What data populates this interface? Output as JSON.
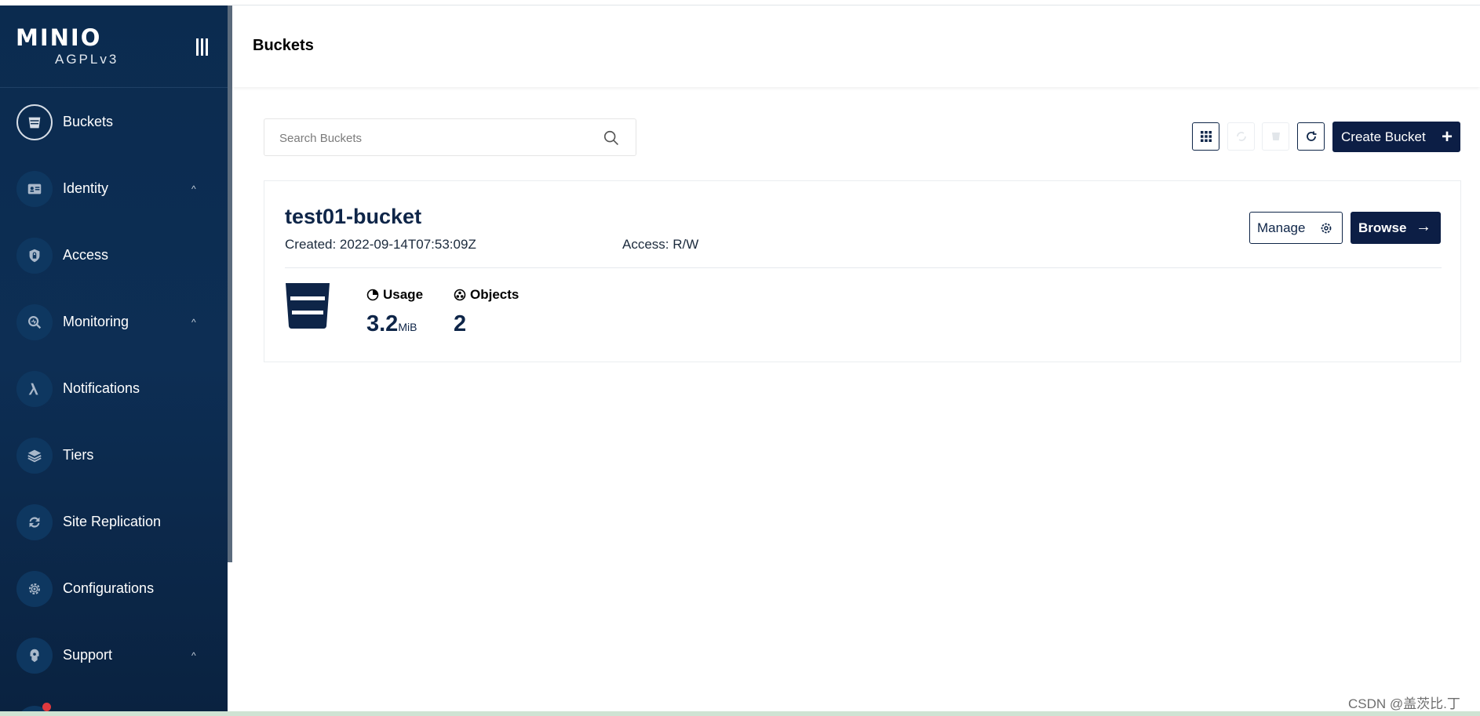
{
  "sidebar": {
    "logo": "MINIO",
    "license": "AGPLv3",
    "items": [
      {
        "label": "Buckets",
        "icon": "bucket-icon",
        "has_chevron": false,
        "active": true
      },
      {
        "label": "Identity",
        "icon": "identity-card-icon",
        "has_chevron": true
      },
      {
        "label": "Access",
        "icon": "lock-shield-icon",
        "has_chevron": false
      },
      {
        "label": "Monitoring",
        "icon": "monitoring-search-icon",
        "has_chevron": true
      },
      {
        "label": "Notifications",
        "icon": "lambda-icon",
        "has_chevron": false
      },
      {
        "label": "Tiers",
        "icon": "layers-icon",
        "has_chevron": false
      },
      {
        "label": "Site Replication",
        "icon": "sync-icon",
        "has_chevron": false
      },
      {
        "label": "Configurations",
        "icon": "gear-icon",
        "has_chevron": false
      },
      {
        "label": "Support",
        "icon": "support-icon",
        "has_chevron": true
      }
    ],
    "chevron": "^"
  },
  "header": {
    "title": "Buckets"
  },
  "toolbar": {
    "search_placeholder": "Search Buckets",
    "create_label": "Create Bucket",
    "create_icon": "+"
  },
  "bucket": {
    "name": "test01-bucket",
    "created": "Created: 2022-09-14T07:53:09Z",
    "access": "Access: R/W",
    "manage_label": "Manage",
    "browse_label": "Browse",
    "browse_icon": "→",
    "usage_label": "Usage",
    "usage_value": "3.2",
    "usage_unit": "MiB",
    "objects_label": "Objects",
    "objects_value": "2"
  },
  "watermark": "CSDN @盖茨比.丁",
  "colors": {
    "sidebar": "#0b2b4f",
    "primary": "#0c1e45",
    "notification_dot": "#e0393e"
  }
}
